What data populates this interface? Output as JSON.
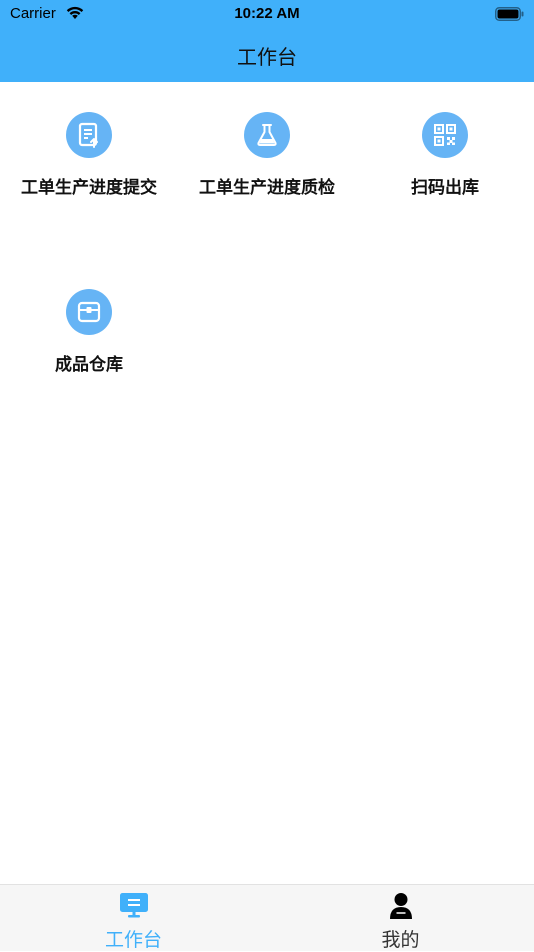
{
  "status_bar": {
    "carrier": "Carrier",
    "time": "10:22 AM"
  },
  "header": {
    "title": "工作台",
    "background": "#40b0fa"
  },
  "grid": {
    "items": [
      {
        "label": "工单生产进度提交",
        "icon": "document-upload-icon"
      },
      {
        "label": "工单生产进度质检",
        "icon": "flask-icon"
      },
      {
        "label": "扫码出库",
        "icon": "qr-code-icon"
      },
      {
        "label": "成品仓库",
        "icon": "box-icon"
      }
    ],
    "icon_color": "#66b4f5"
  },
  "tabbar": {
    "tabs": [
      {
        "label": "工作台",
        "icon": "monitor-icon",
        "active": true
      },
      {
        "label": "我的",
        "icon": "user-icon",
        "active": false
      }
    ],
    "active_color": "#40b0fa",
    "inactive_color": "#333333"
  }
}
